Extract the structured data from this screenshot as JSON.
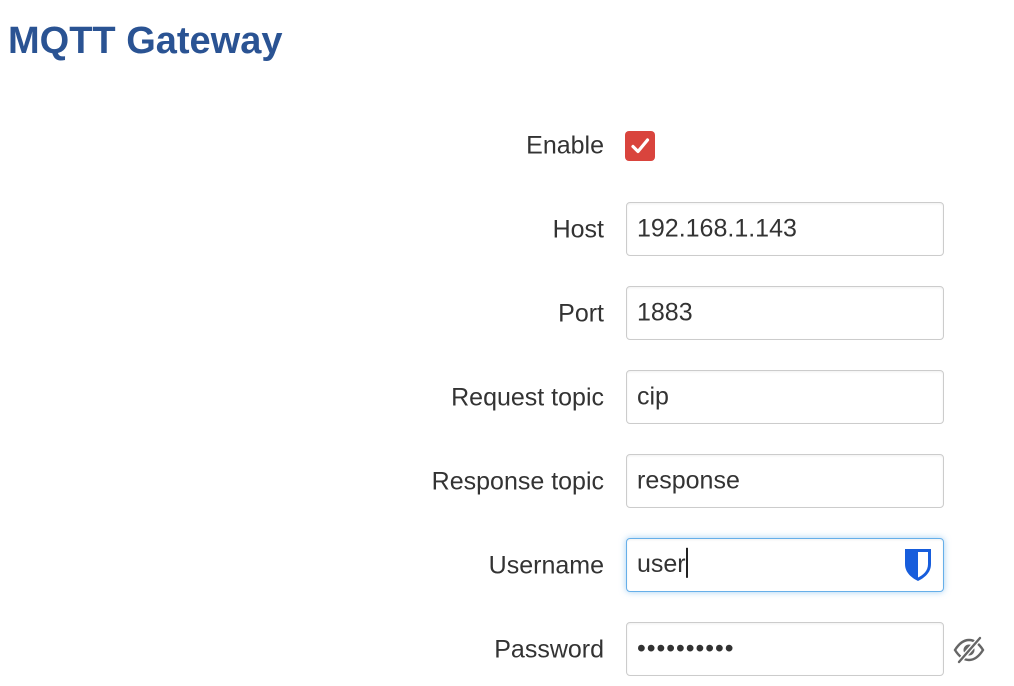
{
  "page": {
    "title": "MQTT Gateway"
  },
  "form": {
    "enable": {
      "label": "Enable",
      "checked": true,
      "color": "#d9443d"
    },
    "host": {
      "label": "Host",
      "value": "192.168.1.143"
    },
    "port": {
      "label": "Port",
      "value": "1883"
    },
    "request_topic": {
      "label": "Request topic",
      "value": "cip"
    },
    "response_topic": {
      "label": "Response topic",
      "value": "response"
    },
    "username": {
      "label": "Username",
      "value": "user",
      "icon": "bitwarden-shield-icon"
    },
    "password": {
      "label": "Password",
      "masked_value": "••••••••••",
      "icon": "eye-slash-icon"
    }
  },
  "colors": {
    "title": "#2a5393",
    "focus_border": "#66afe9",
    "shield": "#175ddc"
  }
}
